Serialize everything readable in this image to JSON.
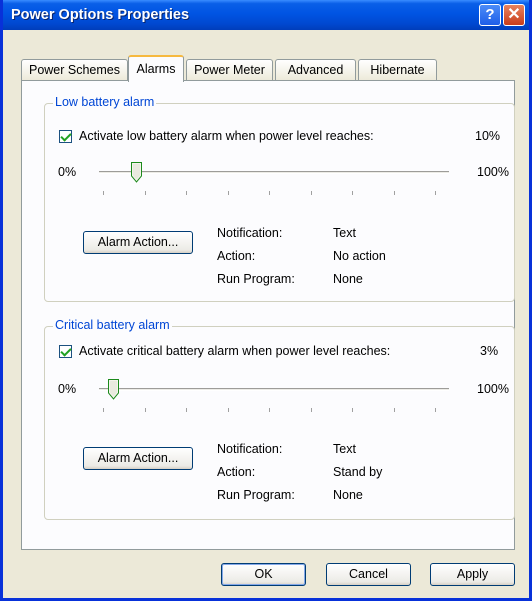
{
  "window": {
    "title": "Power Options Properties",
    "help_label": "?",
    "close_label": "✕"
  },
  "tabs": [
    {
      "label": "Power Schemes"
    },
    {
      "label": "Alarms"
    },
    {
      "label": "Power Meter"
    },
    {
      "label": "Advanced"
    },
    {
      "label": "Hibernate"
    }
  ],
  "active_tab": "Alarms",
  "low_battery": {
    "group_title": "Low battery alarm",
    "checkbox_label": "Activate low battery alarm when power level reaches:",
    "checked": true,
    "level_text": "10%",
    "slider_min": "0%",
    "slider_max": "100%",
    "slider_value": 10,
    "button_label": "Alarm Action...",
    "info": [
      {
        "key": "Notification:",
        "value": "Text"
      },
      {
        "key": "Action:",
        "value": "No action"
      },
      {
        "key": "Run Program:",
        "value": "None"
      }
    ]
  },
  "critical_battery": {
    "group_title": "Critical battery alarm",
    "checkbox_label": "Activate critical battery alarm when power level reaches:",
    "checked": true,
    "level_text": "3%",
    "slider_min": "0%",
    "slider_max": "100%",
    "slider_value": 3,
    "button_label": "Alarm Action...",
    "info": [
      {
        "key": "Notification:",
        "value": "Text"
      },
      {
        "key": "Action:",
        "value": "Stand by"
      },
      {
        "key": "Run Program:",
        "value": "None"
      }
    ]
  },
  "footer": {
    "ok_label": "OK",
    "cancel_label": "Cancel",
    "apply_label": "Apply"
  },
  "colors": {
    "titlebar": "#0054e3",
    "group_title": "#0046d5",
    "check": "#21a121",
    "tab_highlight": "#f6b940"
  }
}
